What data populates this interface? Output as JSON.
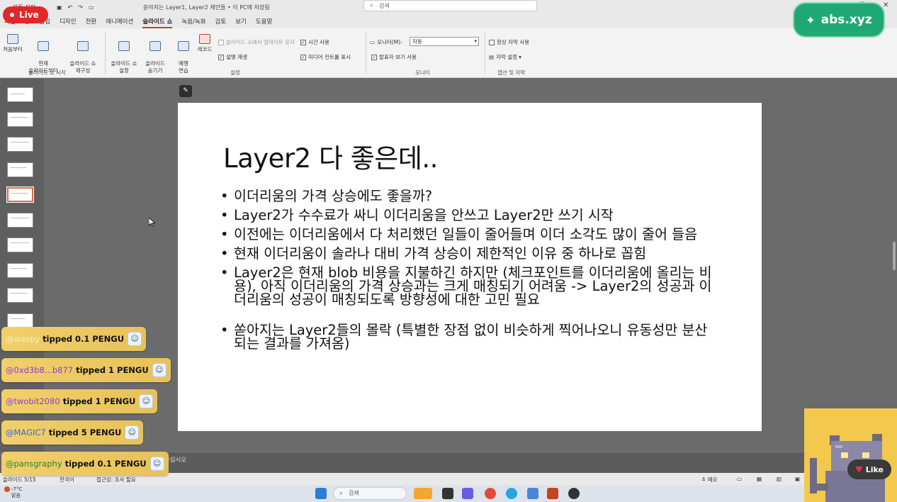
{
  "titlebar": {
    "autosave": "자동 저장",
    "doc_title": "쏟아지는 Layer1, Layer2 제안들 • 이 PC에 저장됨",
    "search_placeholder": "검색"
  },
  "ribbon_tabs": [
    "파일",
    "홈",
    "삽입",
    "디자인",
    "전환",
    "애니메이션",
    "슬라이드 쇼",
    "녹음/녹화",
    "검토",
    "보기",
    "도움말"
  ],
  "active_tab": "슬라이드 쇼",
  "ribbon": {
    "start_group": {
      "from_beginning": "처음부터",
      "from_current": "현재\n슬라이드부터",
      "custom": "슬라이드 쇼\n재구성",
      "label": "슬라이드 쇼 시작"
    },
    "setup_group": {
      "setup": "슬라이드 쇼\n설정",
      "hide": "슬라이드\n숨기기",
      "rehearse": "예행\n연습",
      "record": "레코드",
      "keep_updated": "슬라이드 쇼에서 업데이트 유지",
      "play_narrations": "설명 재생",
      "use_timings": "시간 사용",
      "show_media_controls": "미디어 컨트롤 표시",
      "label": "설정"
    },
    "monitors_group": {
      "monitor_label": "모니터(M):",
      "monitor_value": "자동",
      "presenter_view": "발표자 보기 사용",
      "label": "모니터"
    },
    "captions_group": {
      "always_captions": "항상 자막 사용",
      "caption_settings": "자막 설정",
      "label": "캡션 및 자막"
    }
  },
  "slide": {
    "title": "Layer2 다 좋은데..",
    "bullets": [
      "이더리움의 가격 상승에도 좋을까?",
      "Layer2가 수수료가 싸니 이더리움을 안쓰고 Layer2만 쓰기 시작",
      "이전에는 이더리움에서 다 처리했던 일들이 줄어들며 이더 소각도 많이 줄어 들음",
      "현재 이더리움이 솔라나 대비 가격 상승이 제한적인 이유 중 하나로 꼽힘",
      "Layer2은 현재 blob 비용을 지불하긴 하지만 (체크포인트를 이더리움에 올리는 비용), 아직 이더리움의 가격 상승과는 크게 매칭되기 어려움 -> Layer2의 성공과 이더리움의 성공이 매칭되도록 방향성에 대한 고민  필요",
      "쏟아지는 Layer2들의 몰락 (특별한 장점 없이 비슷하게 찍어나오니 유동성만 분산되는 결과를 가져옴)"
    ]
  },
  "notes_placeholder": "려하십시오",
  "statusbar": {
    "slide_counter": "슬라이드 5/15",
    "language": "한국어",
    "accessibility": "접근성: 조사 필요",
    "notes": "메모"
  },
  "taskbar": {
    "weather_temp": "-7°C",
    "weather_text": "맑음",
    "search_placeholder": "검색"
  },
  "overlays": {
    "live_label": "Live",
    "brand_label": "abs.xyz",
    "like_label": "Like",
    "tips": [
      {
        "user": "@waspy",
        "msg": "tipped 0.1 PENGU",
        "color": "#f3f3a8"
      },
      {
        "user": "@0xd3b8...b877",
        "msg": "tipped 1 PENGU",
        "color": "#8a3fd1"
      },
      {
        "user": "@twobit2080",
        "msg": "tipped 1 PENGU",
        "color": "#8a3fd1"
      },
      {
        "user": "@MAGIC7",
        "msg": "tipped 5 PENGU",
        "color": "#2b6fd9"
      },
      {
        "user": "@pansgraphy",
        "msg": "tipped 0.1 PENGU",
        "color": "#1e8a3a"
      }
    ]
  },
  "colors": {
    "accent": "#b7472a",
    "live_red": "#e4262a",
    "brand_green": "#20a874",
    "tip_gold": "#f1cf6a"
  }
}
